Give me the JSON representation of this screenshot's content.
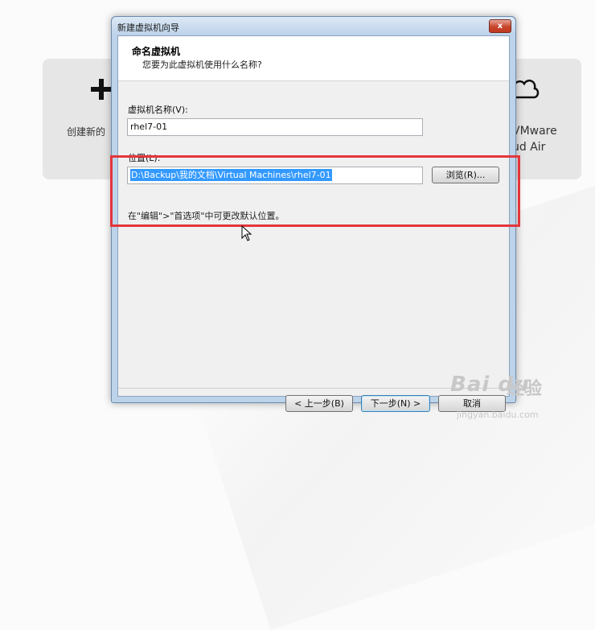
{
  "background": {
    "left_card_label": "创建新的",
    "right_card_lines": [
      "VMware",
      "ud Air"
    ]
  },
  "dialog": {
    "title": "新建虚拟机向导",
    "close_symbol": "x",
    "header_title": "命名虚拟机",
    "header_subtitle": "您要为此虚拟机使用什么名称?",
    "name_label": "虚拟机名称(V):",
    "name_value": "rhel7-01",
    "location_label": "位置(L):",
    "location_value": "D:\\Backup\\我的文档\\Virtual Machines\\rhel7-01",
    "browse_button": "浏览(R)...",
    "hint": "在\"编辑\">\"首选项\"中可更改默认位置。",
    "back_button": "< 上一步(B)",
    "next_button": "下一步(N) >",
    "cancel_button": "取消"
  },
  "annotation": {
    "color": "#e3363b"
  },
  "watermark": {
    "logo": "Bai du",
    "text": "经验",
    "url": "jingyan.baidu.com"
  }
}
